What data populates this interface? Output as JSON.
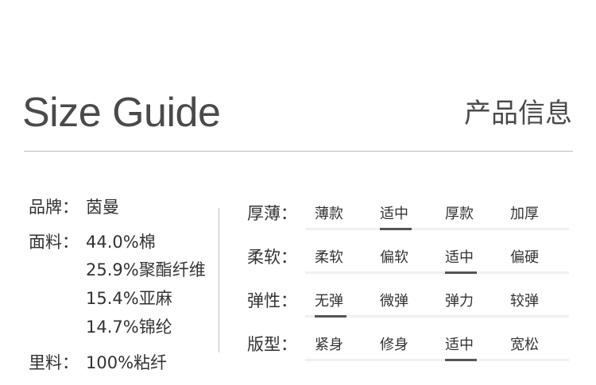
{
  "header": {
    "title_en": "Size Guide",
    "title_cn": "产品信息"
  },
  "info": [
    {
      "label": "品牌：",
      "values": [
        "茵曼"
      ]
    },
    {
      "label": "面料：",
      "values": [
        "44.0%棉",
        "25.9%聚酯纤维",
        "15.4%亚麻",
        "14.7%锦纶"
      ]
    },
    {
      "label": "里料：",
      "values": [
        "100%粘纤"
      ]
    }
  ],
  "attributes": [
    {
      "label": "厚薄：",
      "options": [
        "薄款",
        "适中",
        "厚款",
        "加厚"
      ],
      "selected": 1
    },
    {
      "label": "柔软：",
      "options": [
        "柔软",
        "偏软",
        "适中",
        "偏硬"
      ],
      "selected": 2
    },
    {
      "label": "弹性：",
      "options": [
        "无弹",
        "微弹",
        "弹力",
        "较弹"
      ],
      "selected": 0
    },
    {
      "label": "版型：",
      "options": [
        "紧身",
        "修身",
        "适中",
        "宽松"
      ],
      "selected": 2
    }
  ],
  "colors": {
    "text": "#333333",
    "title": "#4a4a4a",
    "rule": "#bdbdbd",
    "selected_underline": "#555555",
    "track": "#f0f0f0"
  }
}
